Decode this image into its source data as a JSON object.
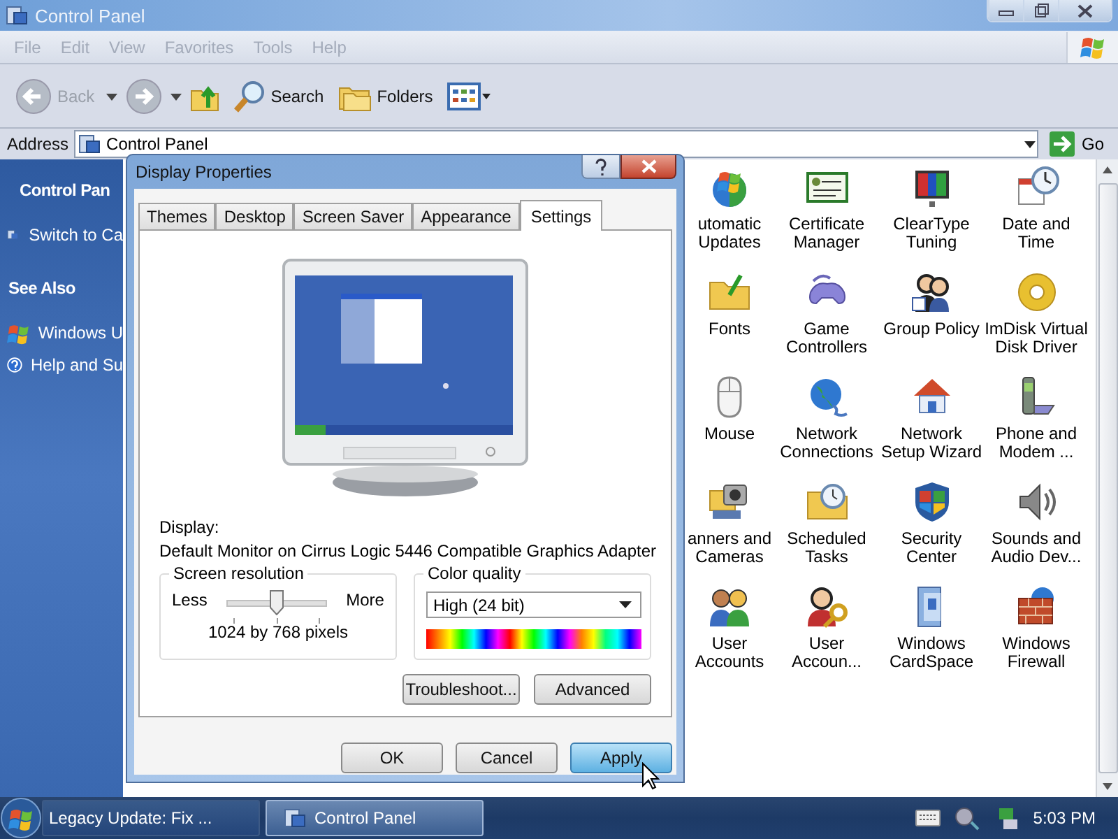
{
  "window": {
    "title": "Control Panel"
  },
  "menu": [
    "File",
    "Edit",
    "View",
    "Favorites",
    "Tools",
    "Help"
  ],
  "toolbar": {
    "back": {
      "label": "Back",
      "disabled": true
    },
    "search": {
      "label": "Search"
    },
    "folders": {
      "label": "Folders"
    }
  },
  "address": {
    "label": "Address",
    "value": "Control Panel",
    "go": "Go"
  },
  "sidebar": {
    "sections": [
      {
        "title": "Control Pan",
        "items": [
          "Switch to Ca"
        ]
      },
      {
        "title": "See Also",
        "items": [
          "Windows U",
          "Help and Su"
        ]
      }
    ]
  },
  "icons": [
    {
      "label": "utomatic Updates"
    },
    {
      "label": "Certificate Manager"
    },
    {
      "label": "ClearType Tuning"
    },
    {
      "label": "Date and Time"
    },
    {
      "label": "Fonts"
    },
    {
      "label": "Game Controllers"
    },
    {
      "label": "Group Policy"
    },
    {
      "label": "ImDisk Virtual Disk Driver"
    },
    {
      "label": "Mouse"
    },
    {
      "label": "Network Connections"
    },
    {
      "label": "Network Setup Wizard"
    },
    {
      "label": "Phone and Modem ..."
    },
    {
      "label": "anners and Cameras"
    },
    {
      "label": "Scheduled Tasks"
    },
    {
      "label": "Security Center"
    },
    {
      "label": "Sounds and Audio Dev..."
    },
    {
      "label": "User Accounts"
    },
    {
      "label": "User Accoun..."
    },
    {
      "label": "Windows CardSpace"
    },
    {
      "label": "Windows Firewall"
    }
  ],
  "dialog": {
    "title": "Display Properties",
    "tabs": [
      {
        "label": "Themes",
        "selected": false
      },
      {
        "label": "Desktop",
        "selected": false
      },
      {
        "label": "Screen Saver",
        "selected": false
      },
      {
        "label": "Appearance",
        "selected": false
      },
      {
        "label": "Settings",
        "selected": true
      }
    ],
    "display_label": "Display:",
    "adapter": "Default Monitor on Cirrus Logic 5446 Compatible Graphics Adapter",
    "resolution": {
      "title": "Screen resolution",
      "less": "Less",
      "more": "More",
      "level": 0.5,
      "reading": "1024 by 768 pixels"
    },
    "color_quality": {
      "title": "Color quality",
      "value": "High (24 bit)"
    },
    "buttons": [
      {
        "label": "Troubleshoot..."
      },
      {
        "label": "Advanced"
      }
    ],
    "footer_buttons": [
      {
        "label": "OK",
        "hovered": false
      },
      {
        "label": "Cancel",
        "hovered": false
      },
      {
        "label": "Apply",
        "hovered": true
      }
    ]
  },
  "taskbar": {
    "tasks": [
      {
        "label": "Legacy Update: Fix ...",
        "selected": false
      },
      {
        "label": "Control Panel",
        "selected": true
      }
    ],
    "clock": "5:03 PM"
  }
}
